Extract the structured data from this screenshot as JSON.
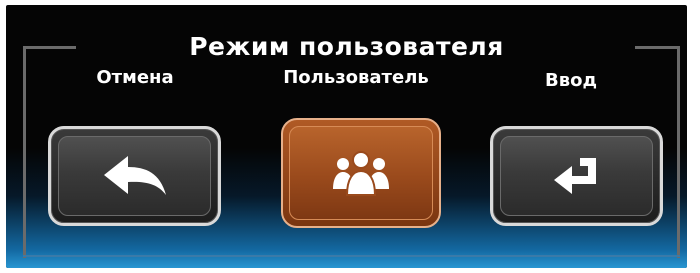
{
  "title": "Режим пользователя",
  "buttons": {
    "cancel": {
      "label": "Отмена",
      "icon": "back-arrow-icon"
    },
    "user": {
      "label": "Пользователь",
      "icon": "users-group-icon"
    },
    "enter": {
      "label": "Ввод",
      "icon": "enter-return-icon"
    }
  },
  "colors": {
    "background": "#050505",
    "accent_glow": "#2896d2",
    "active_button": "#a3501f",
    "button_gray": "#3a3a3a",
    "text": "#ffffff"
  }
}
